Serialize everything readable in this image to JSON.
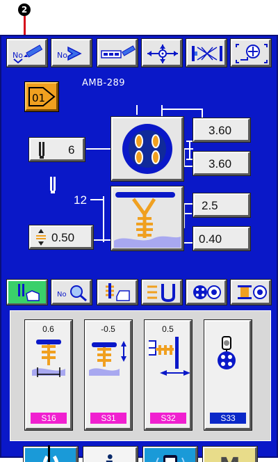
{
  "callout_top": "2",
  "top_toolbar": [
    {
      "id": "program-no-edit",
      "icon": "program-number-pencil-icon"
    },
    {
      "id": "program-no-select",
      "icon": "program-number-arrow-icon"
    },
    {
      "id": "sequence-edit",
      "icon": "sequence-pencil-icon"
    },
    {
      "id": "origin-position",
      "icon": "origin-position-icon"
    },
    {
      "id": "stitch-shape",
      "icon": "stitch-shape-icon"
    },
    {
      "id": "button-setting",
      "icon": "button-setting-icon"
    }
  ],
  "model": "AMB-289",
  "program_number": "01",
  "needle": {
    "value": "6"
  },
  "holes_spacing_x": "3.60",
  "holes_spacing_y": "3.60",
  "shank_count": "12",
  "shank_offset": "0.50",
  "shank_height": "2.5",
  "shank_base": "0.40",
  "function_bar": [
    {
      "icon": "needle-hand-icon"
    },
    {
      "icon": "program-zoom-icon"
    },
    {
      "icon": "thread-cutter-icon"
    },
    {
      "icon": "clamp-u-icon"
    },
    {
      "icon": "button-counter-icon"
    },
    {
      "icon": "bobbin-counter-icon"
    }
  ],
  "sub_buttons": [
    {
      "value": "0.6",
      "tag": "S16",
      "icon": "height-offset-icon",
      "color": "#f020d0"
    },
    {
      "value": "-0.5",
      "tag": "S31",
      "icon": "vertical-offset-icon",
      "color": "#f020d0"
    },
    {
      "value": "0.5",
      "tag": "S32",
      "icon": "horizontal-offset-icon",
      "color": "#f020d0"
    },
    {
      "value": "",
      "tag": "S33",
      "icon": "button-clamp-icon",
      "color": "#0a28c8"
    }
  ],
  "bottom_bar": [
    {
      "icon": "ready-icon",
      "label": ""
    },
    {
      "icon": "info-icon",
      "label": "i"
    },
    {
      "icon": "communication-icon",
      "label": ""
    },
    {
      "icon": "mode-icon",
      "label": "M"
    }
  ]
}
